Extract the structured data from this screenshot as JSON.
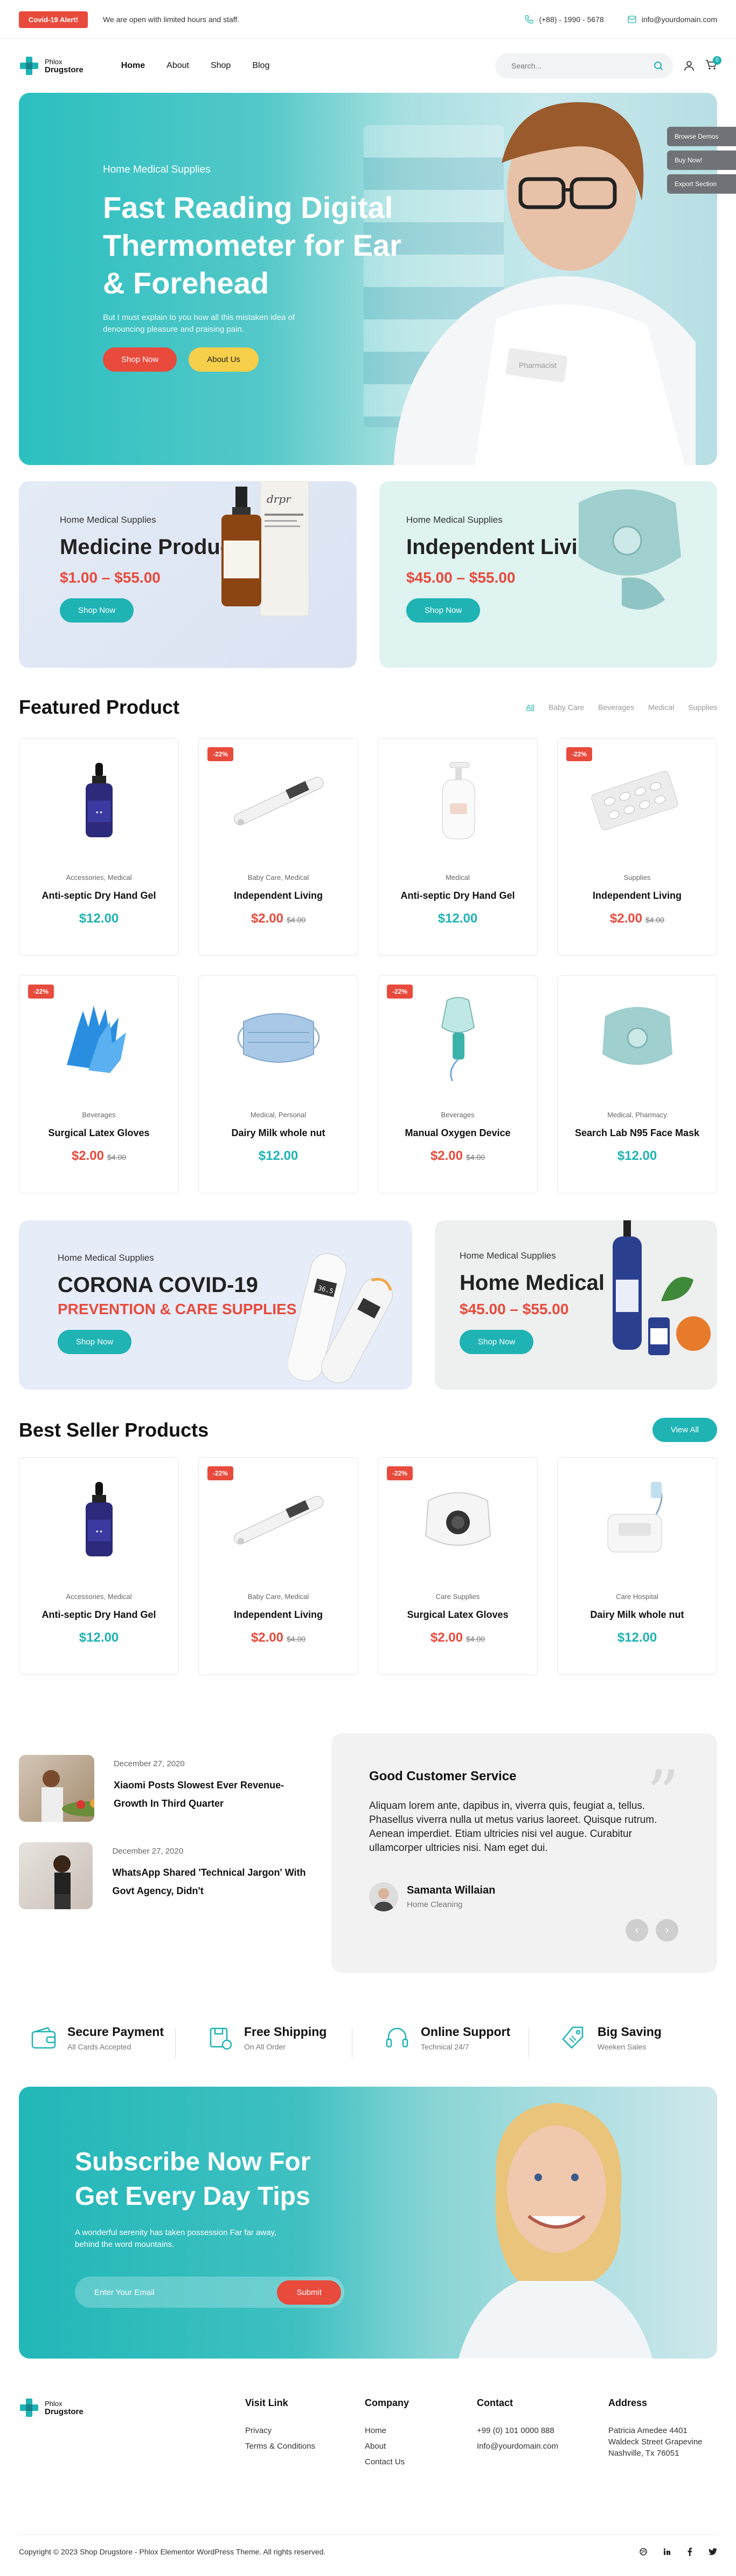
{
  "topbar": {
    "alert": "Covid-19 Alert!",
    "message": "We are open with limited hours and staff.",
    "phone": "(+88) - 1990 - 5678",
    "email": "info@yourdomain.com"
  },
  "header": {
    "logo_line1": "Phlox",
    "logo_line2": "Drugstore",
    "nav": [
      "Home",
      "About",
      "Shop",
      "Blog"
    ],
    "search_placeholder": "Search...",
    "cart_count": "0"
  },
  "side_tabs": [
    "Browse Demos",
    "Buy Now!",
    "Export Section"
  ],
  "hero": {
    "subtitle": "Home Medical Supplies",
    "title": "Fast Reading Digital Thermometer for Ear & Forehead",
    "text": "But I must explain to you how all this mistaken idea of denouncing pleasure and praising pain.",
    "btn_primary": "Shop Now",
    "btn_secondary": "About Us",
    "doctor_badge": "Pharmacist"
  },
  "promos": [
    {
      "subtitle": "Home Medical Supplies",
      "title": "Medicine Product",
      "price": "$1.00 – $55.00",
      "button": "Shop Now",
      "brand": "drpr"
    },
    {
      "subtitle": "Home Medical Supplies",
      "title": "Independent Living",
      "price": "$45.00 – $55.00",
      "button": "Shop Now"
    }
  ],
  "featured": {
    "title": "Featured Product",
    "filters": [
      "All",
      "Baby Care",
      "Beverages",
      "Medical",
      "Supplies"
    ],
    "products": [
      {
        "cat": "Accessories, Medical",
        "name": "Anti-septic Dry Hand Gel",
        "price": "$12.00",
        "old": "",
        "sale": "",
        "img": "dropper"
      },
      {
        "cat": "Baby Care, Medical",
        "name": "Independent Living",
        "price": "$2.00",
        "old": "$4.00",
        "sale": "-22%",
        "img": "thermometer"
      },
      {
        "cat": "Medical",
        "name": "Anti-septic Dry Hand Gel",
        "price": "$12.00",
        "old": "",
        "sale": "",
        "img": "pump-bottle"
      },
      {
        "cat": "Supplies",
        "name": "Independent Living",
        "price": "$2.00",
        "old": "$4.00",
        "sale": "-22%",
        "img": "pills"
      },
      {
        "cat": "Beverages",
        "name": "Surgical Latex Gloves",
        "price": "$2.00",
        "old": "$4.00",
        "sale": "-22%",
        "img": "gloves"
      },
      {
        "cat": "Medical, Personal",
        "name": "Dairy Milk whole nut",
        "price": "$12.00",
        "old": "",
        "sale": "",
        "img": "mask"
      },
      {
        "cat": "Beverages",
        "name": "Manual Oxygen Device",
        "price": "$2.00",
        "old": "$4.00",
        "sale": "-22%",
        "img": "nebulizer-mask"
      },
      {
        "cat": "Medical, Pharmacy",
        "name": "Search Lab N95 Face Mask",
        "price": "$12.00",
        "old": "",
        "sale": "",
        "img": "n95"
      }
    ]
  },
  "banners2": [
    {
      "subtitle": "Home Medical Supplies",
      "title": "CORONA COVID-19",
      "title2": "PREVENTION & CARE SUPPLIES",
      "button": "Shop Now",
      "reading": "36.5"
    },
    {
      "subtitle": "Home Medical Supplies",
      "title": "Home Medical",
      "price": "$45.00 – $55.00",
      "button": "Shop Now"
    }
  ],
  "bestseller": {
    "title": "Best Seller Products",
    "button": "View All",
    "products": [
      {
        "cat": "Accessories, Medical",
        "name": "Anti-septic Dry Hand Gel",
        "price": "$12.00",
        "old": "",
        "sale": "",
        "img": "dropper"
      },
      {
        "cat": "Baby Care, Medical",
        "name": "Independent Living",
        "price": "$2.00",
        "old": "$4.00",
        "sale": "-22%",
        "img": "thermometer"
      },
      {
        "cat": "Care Supplies",
        "name": "Surgical Latex Gloves",
        "price": "$2.00",
        "old": "$4.00",
        "sale": "-22%",
        "img": "respirator"
      },
      {
        "cat": "Care Hospital",
        "name": "Dairy Milk whole nut",
        "price": "$12.00",
        "old": "",
        "sale": "",
        "img": "nebulizer"
      }
    ]
  },
  "posts": [
    {
      "date": "December 27, 2020",
      "title": "Xiaomi Posts Slowest Ever Revenue-Growth In Third Quarter"
    },
    {
      "date": "December 27, 2020",
      "title": "WhatsApp Shared 'Technical Jargon' With Govt Agency, Didn't"
    }
  ],
  "testimonial": {
    "title": "Good Customer Service",
    "quote": "Aliquam lorem ante, dapibus in, viverra quis, feugiat a, tellus. Phasellus viverra nulla ut metus varius laoreet. Quisque rutrum. Aenean imperdiet. Etiam ultricies nisi vel augue. Curabitur ullamcorper ultricies nisi. Nam eget dui.",
    "name": "Samanta Willaian",
    "role": "Home Cleaning"
  },
  "features": [
    {
      "title": "Secure Payment",
      "sub": "All Cards Accepted",
      "icon": "wallet-icon"
    },
    {
      "title": "Free Shipping",
      "sub": "On All Order",
      "icon": "box-icon"
    },
    {
      "title": "Online Support",
      "sub": "Technical 24/7",
      "icon": "headset-icon"
    },
    {
      "title": "Big Saving",
      "sub": "Weeken Sales",
      "icon": "tag-icon"
    }
  ],
  "subscribe": {
    "title_line1": "Subscribe Now For",
    "title_line2": "Get Every Day Tips",
    "text": "A wonderful serenity has taken possession Far far away, behind the word mountains.",
    "placeholder": "Enter Your Email",
    "button": "Submit"
  },
  "footer": {
    "logo_line1": "Phlox",
    "logo_line2": "Drugstore",
    "visit_title": "Visit Link",
    "visit": [
      "Privacy",
      "Terms & Conditions"
    ],
    "company_title": "Company",
    "company": [
      "Home",
      "About",
      "Contact Us"
    ],
    "contact_title": "Contact",
    "contact": [
      "+99 (0) 101 0000 888",
      "Info@yourdomain.com"
    ],
    "address_title": "Address",
    "address": [
      "Patricia Amedee 4401",
      "Waldeck Street Grapevine",
      "Nashville, Tx 76051"
    ],
    "copyright": "Copyright © 2023 Shop Drugstore - Phlox Elementor WordPress Theme. All rights reserved."
  },
  "colors": {
    "teal": "#1fb3b4",
    "red": "#e84a3c",
    "yellow": "#f7cf4a"
  }
}
